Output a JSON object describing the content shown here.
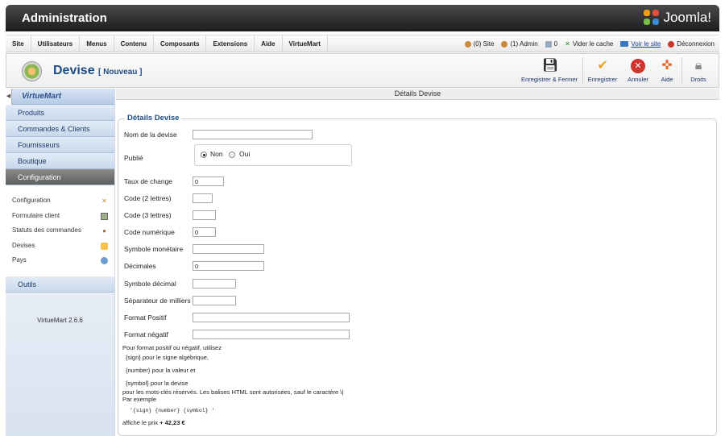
{
  "header": {
    "title": "Administration",
    "brand": "Joomla!"
  },
  "menu": {
    "items": [
      "Site",
      "Utilisateurs",
      "Menus",
      "Contenu",
      "Composants",
      "Extensions",
      "Aide",
      "VirtueMart"
    ],
    "status": {
      "site": "(0) Site",
      "admin": "(1) Admin",
      "messages": "0",
      "clear_cache": "Vider le cache",
      "view_site": "Voir le site",
      "logout": "Déconnexion"
    }
  },
  "toolbar": {
    "title": "Devise",
    "subtitle": "[ Nouveau ]",
    "buttons": {
      "save_close": "Enregistrer & Fermer",
      "save": "Enregistrer",
      "cancel": "Annuler",
      "help": "Aide",
      "rights": "Droits"
    }
  },
  "sidebar": {
    "brand": "VirtueMart",
    "categories": [
      "Produits",
      "Commandes & Clients",
      "Fournisseurs",
      "Boutique",
      "Configuration"
    ],
    "sub_items": [
      "Configuration",
      "Formulaire client",
      "Statuts des commandes",
      "Devises",
      "Pays"
    ],
    "tools": "Outils",
    "version": "VirtueMart 2.6.6"
  },
  "main": {
    "header": "Détails Devise",
    "legend": "Détails Devise",
    "fields": {
      "name": {
        "label": "Nom de la devise",
        "value": ""
      },
      "published": {
        "label": "Publié",
        "options": [
          "Non",
          "Oui"
        ],
        "selected": "Non"
      },
      "exchange_rate": {
        "label": "Taux de change",
        "value": "0"
      },
      "code2": {
        "label": "Code (2 lettres)",
        "value": ""
      },
      "code3": {
        "label": "Code (3 lettres)",
        "value": ""
      },
      "numeric_code": {
        "label": "Code numérique",
        "value": "0"
      },
      "symbol": {
        "label": "Symbole monétaire",
        "value": ""
      },
      "decimals": {
        "label": "Décimales",
        "value": "0"
      },
      "decimal_symbol": {
        "label": "Symbole décimal",
        "value": ""
      },
      "thousands_sep": {
        "label": "Séparateur de milliers",
        "value": ""
      },
      "positive_format": {
        "label": "Format Positif",
        "value": ""
      },
      "negative_format": {
        "label": "Format négatif",
        "value": ""
      }
    },
    "help": {
      "line1": "Pour format positif ou négatif, utilisez",
      "line2": "{sign} pour le signe algébrique,",
      "line3": "{number} pour la valeur et",
      "line4": "{symbol} pour la devise",
      "line5": "pour les mots-clés réservés. Les balises HTML sont autorisées, sauf le caractère \\|",
      "line6": "Par exemple",
      "example": "'{sign} {number} {symbol} '",
      "result_prefix": "affiche le prix ",
      "result_value": "+ 42,23 €"
    }
  },
  "colors": {
    "accent": "#1d4d86",
    "topbar": "#2a2a2a",
    "active_nav": "#6b6b6b"
  }
}
